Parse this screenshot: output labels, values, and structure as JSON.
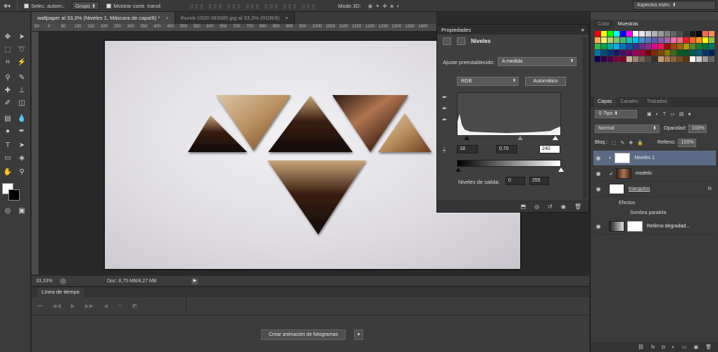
{
  "options_bar": {
    "auto_select_label": "Selec. autom.:",
    "auto_select_value": "Grupo",
    "show_transform_label": "Mostrar contr. transf.",
    "mode_3d_label": "Modo 3D:"
  },
  "document_tabs": [
    {
      "label": "wallpaper al 33,3% (Niveles 1, Máscara de capa/8) *",
      "close": "×"
    },
    {
      "label": "thumb-1920-383685.jpg al 33,3% (RGB/8)",
      "close": "×"
    }
  ],
  "ruler_ticks": [
    "50",
    "0",
    "50",
    "100",
    "150",
    "200",
    "250",
    "300",
    "350",
    "400",
    "450",
    "500",
    "550",
    "600",
    "650",
    "700",
    "750",
    "800",
    "850",
    "900",
    "950",
    "1000",
    "1050",
    "1100",
    "1150",
    "1200",
    "1250",
    "1300",
    "1350",
    "1400"
  ],
  "status": {
    "zoom": "33,33%",
    "doc_size": "Doc: 8,75 MB/8,27 MB"
  },
  "timeline": {
    "title": "Línea de tiempo",
    "create_button": "Crear animación de fotogramas"
  },
  "properties": {
    "title": "Propiedades",
    "adjustment_name": "Niveles",
    "preset_label": "Ajuste preestablecido:",
    "preset_value": "A medida",
    "channel_value": "RGB",
    "auto_button": "Automático",
    "input_black": "18",
    "input_gamma": "0,70",
    "input_white": "240",
    "output_label": "Niveles de salida:",
    "output_black": "0",
    "output_white": "255"
  },
  "right_panel": {
    "workspace": "Aspectos esen.",
    "top_tabs": [
      "Color",
      "Muestras"
    ],
    "layer_tabs": [
      "Capas",
      "Canales",
      "Trazados"
    ],
    "kind_filter": "Tipo",
    "blend_mode": "Normal",
    "opacity_label": "Opacidad:",
    "opacity_value": "100%",
    "lock_label": "Bloq.:",
    "fill_label": "Relleno:",
    "fill_value": "100%",
    "layers": [
      {
        "name": "Niveles 1"
      },
      {
        "name": "modelo"
      },
      {
        "name": "triangulos",
        "fx": "fx"
      },
      {
        "name": "Relleno degradad..."
      }
    ],
    "effects_label": "Efectos",
    "effect_item": "Sombra paralela"
  },
  "swatch_colors": [
    "#ff0000",
    "#ffff00",
    "#00ff00",
    "#00ffff",
    "#0000ff",
    "#ff00ff",
    "#ffffff",
    "#e6e6e6",
    "#cccccc",
    "#b3b3b3",
    "#999999",
    "#808080",
    "#666666",
    "#4d4d4d",
    "#333333",
    "#1a1a1a",
    "#000000",
    "#f26c4f",
    "#f68e56",
    "#fbaf5d",
    "#fff568",
    "#acd373",
    "#7cc576",
    "#3cb878",
    "#1cbbb4",
    "#00bff3",
    "#438ccb",
    "#5674b9",
    "#605ca8",
    "#855fa8",
    "#a763a8",
    "#f06ea9",
    "#f26d7d",
    "#ed1c24",
    "#f26522",
    "#f7941d",
    "#fff200",
    "#8dc63f",
    "#39b54a",
    "#00a651",
    "#00a99d",
    "#00aeef",
    "#0072bc",
    "#0054a6",
    "#2e3192",
    "#662d91",
    "#92278f",
    "#ec008c",
    "#ed145b",
    "#9e0b0f",
    "#a0410d",
    "#a3620a",
    "#aba000",
    "#598527",
    "#197b30",
    "#007236",
    "#00746b",
    "#0076a3",
    "#004a80",
    "#003471",
    "#1b1464",
    "#440e62",
    "#630460",
    "#9e005d",
    "#9e0039",
    "#790000",
    "#7b2e00",
    "#7d4900",
    "#827b00",
    "#406618",
    "#005e20",
    "#005826",
    "#005952",
    "#005b7f",
    "#003663",
    "#002157",
    "#0d004c",
    "#32004b",
    "#4b0049",
    "#7b0046",
    "#7a0026",
    "#c7b299",
    "#998675",
    "#736357",
    "#534741",
    "#37302a",
    "#c69c6d",
    "#a67c52",
    "#8c6239",
    "#754c24",
    "#603913",
    "#ffffff",
    "#cccccc",
    "#999999",
    "#666666"
  ],
  "colors": {
    "accent_selection": "#5b6a85",
    "canvas_bg": "#e8e6ea"
  }
}
